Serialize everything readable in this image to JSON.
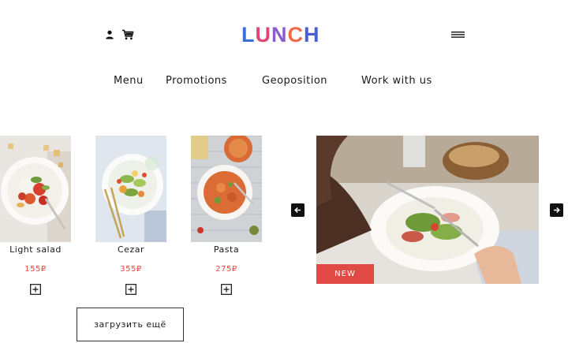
{
  "header": {
    "logo_text": "LUNCH",
    "logo_colors": [
      "#3b6fd8",
      "#e0457b",
      "#8a5cd0",
      "#f06a4b",
      "#4a5fd6"
    ],
    "icons": [
      "user-icon",
      "cart-icon",
      "menu-icon"
    ]
  },
  "nav": {
    "items": [
      {
        "label": "Menu"
      },
      {
        "label": "Promotions"
      },
      {
        "label": "Geoposition"
      },
      {
        "label": "Work with us"
      }
    ]
  },
  "products": [
    {
      "name": "Light salad",
      "price": "155₽"
    },
    {
      "name": "Cezar",
      "price": "355₽"
    },
    {
      "name": "Pasta",
      "price": "275₽"
    }
  ],
  "load_more": {
    "label": "загрузить ещё"
  },
  "promo": {
    "badge": "NEW"
  },
  "colors": {
    "accent": "#e04a45",
    "price": "#e5483f",
    "text": "#1a1a1a"
  }
}
